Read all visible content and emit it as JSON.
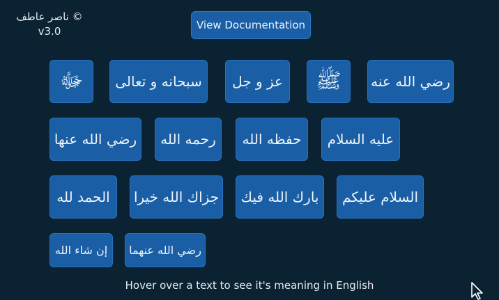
{
  "credit": {
    "name": "ناصر عاطف ©",
    "version": "v3.0"
  },
  "header": {
    "doc_button": "View Documentation"
  },
  "phrases": {
    "row1": [
      "رضي الله عنه",
      "ﷺ",
      "عز و جل",
      "سبحانه و تعالى",
      "ﷻ"
    ],
    "row2": [
      "عليه السلام",
      "حفظه الله",
      "رحمه الله",
      "رضي الله عنها"
    ],
    "row3": [
      "السلام عليكم",
      "بارك الله فيك",
      "جزاك الله خيرا",
      "الحمد لله"
    ],
    "row4": [
      "رضي الله عنهما",
      "إن شاء الله"
    ]
  },
  "hint": "Hover over a text to see it's meaning in English",
  "colors": {
    "background": "#0b2233",
    "button": "#1a5ea6",
    "text": "#eef4fa"
  }
}
